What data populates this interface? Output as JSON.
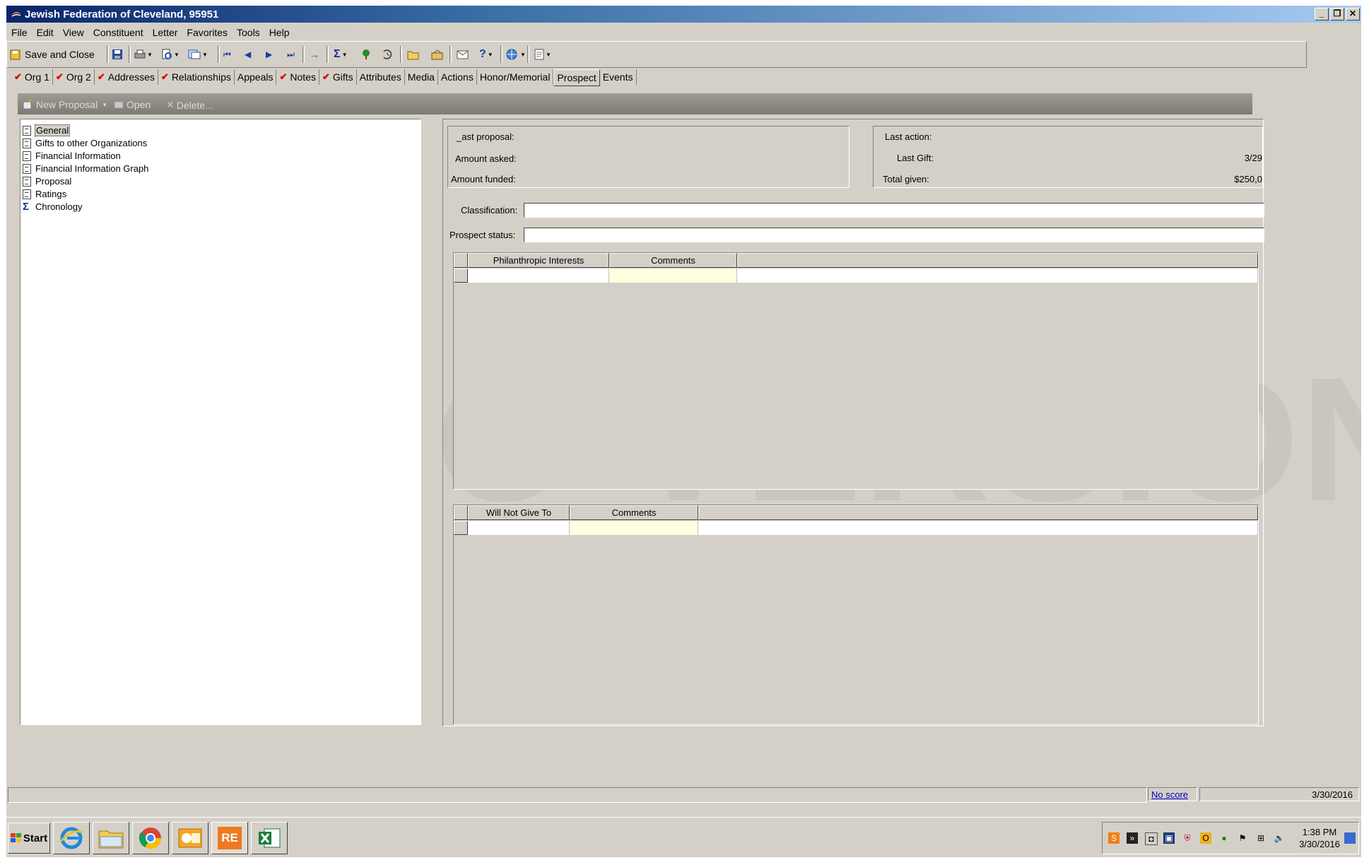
{
  "window": {
    "title": "Jewish Federation of Cleveland, 95951",
    "buttons": [
      "_",
      "❐",
      "✕"
    ]
  },
  "menu": [
    "File",
    "Edit",
    "View",
    "Constituent",
    "Letter",
    "Favorites",
    "Tools",
    "Help"
  ],
  "toolbar": {
    "save_close_label": "Save and Close"
  },
  "tabs": [
    {
      "label": "Org 1",
      "checked": true
    },
    {
      "label": "Org 2",
      "checked": true
    },
    {
      "label": "Addresses",
      "checked": true
    },
    {
      "label": "Relationships",
      "checked": true
    },
    {
      "label": "Appeals",
      "checked": false
    },
    {
      "label": "Notes",
      "checked": true
    },
    {
      "label": "Gifts",
      "checked": true
    },
    {
      "label": "Attributes",
      "checked": false
    },
    {
      "label": "Media",
      "checked": false
    },
    {
      "label": "Actions",
      "checked": false
    },
    {
      "label": "Honor/Memorial",
      "checked": false
    },
    {
      "label": "Prospect",
      "checked": false,
      "active": true
    },
    {
      "label": "Events",
      "checked": false
    }
  ],
  "actionbar": {
    "new_proposal": "New Proposal",
    "open": "Open",
    "delete": "Delete..."
  },
  "tree": [
    {
      "label": "General",
      "icon": "doc",
      "selected": true
    },
    {
      "label": "Gifts to other Organizations",
      "icon": "doc"
    },
    {
      "label": "Financial Information",
      "icon": "doc"
    },
    {
      "label": "Financial Information Graph",
      "icon": "doc"
    },
    {
      "label": "Proposal",
      "icon": "doc"
    },
    {
      "label": "Ratings",
      "icon": "doc"
    },
    {
      "label": "Chronology",
      "icon": "sigma"
    }
  ],
  "summary_left": {
    "last_proposal": "_ast proposal:",
    "amount_asked": "Amount asked:",
    "amount_funded": "Amount funded:"
  },
  "summary_right": {
    "last_action": "Last action:",
    "last_gift": "Last Gift:",
    "last_gift_value": "3/29",
    "total_given": "Total given:",
    "total_given_value": "$250,0"
  },
  "classification_label": "Classification:",
  "prospect_status_label": "Prospect status:",
  "grid1": {
    "col1": "Philanthropic Interests",
    "col2": "Comments"
  },
  "grid2": {
    "col1": "Will Not Give To",
    "col2": "Comments"
  },
  "watermark": "DEMO VERSION",
  "status": {
    "score_link": "No score",
    "date": "3/30/2016"
  },
  "taskbar": {
    "start": "Start",
    "apps": [
      "internet-explorer",
      "file-explorer",
      "chrome",
      "outlook",
      "raisers-edge",
      "excel"
    ],
    "re_label": "RE",
    "time": "1:38 PM",
    "date": "3/30/2016"
  }
}
